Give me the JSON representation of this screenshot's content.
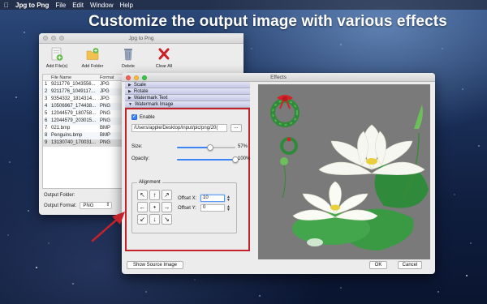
{
  "menubar": {
    "apple_icon": "apple-logo-icon",
    "app_name": "Jpg to Png",
    "items": [
      "File",
      "Edit",
      "Window",
      "Help"
    ]
  },
  "headline": "Customize the output image with various effects",
  "main_window": {
    "title": "Jpg to Png",
    "toolbar": [
      {
        "label": "Add File(s)",
        "icon": "add-file-icon"
      },
      {
        "label": "Add Folder",
        "icon": "add-folder-icon"
      },
      {
        "label": "Delete",
        "icon": "trash-icon"
      },
      {
        "label": "Clear All",
        "icon": "clear-x-icon"
      }
    ],
    "columns": [
      "File Name",
      "Format"
    ],
    "files": [
      {
        "n": "1",
        "name": "9211776_1043556...",
        "fmt": "JPG"
      },
      {
        "n": "2",
        "name": "9211776_1049117...",
        "fmt": "JPG"
      },
      {
        "n": "3",
        "name": "9354332_1814314...",
        "fmt": "JPG"
      },
      {
        "n": "4",
        "name": "10506967_174438...",
        "fmt": "PNG"
      },
      {
        "n": "5",
        "name": "12044579_180758...",
        "fmt": "PNG"
      },
      {
        "n": "6",
        "name": "12044579_203015...",
        "fmt": "PNG"
      },
      {
        "n": "7",
        "name": "021.bmp",
        "fmt": "BMP"
      },
      {
        "n": "8",
        "name": "Penguins.bmp",
        "fmt": "BMP"
      },
      {
        "n": "9",
        "name": "13130740_170031...",
        "fmt": "PNG"
      }
    ],
    "output_folder_label": "Output Folder:",
    "output_format_label": "Output Format:",
    "output_format_value": "PNG"
  },
  "effects": {
    "title": "Effects",
    "sections": [
      "Scale",
      "Rotate",
      "Watermark Text",
      "Watermark Image"
    ],
    "enable_label": "Enable",
    "enable_checked": true,
    "path": "/Users/apple/Desktop/input/pic/png/20(",
    "browse_label": "...",
    "size_label": "Size:",
    "size_value": "57%",
    "size_fraction": 0.57,
    "opacity_label": "Opacity:",
    "opacity_value": "100%",
    "opacity_fraction": 1.0,
    "alignment_label": "Alignment",
    "align_buttons": [
      "↖",
      "↑",
      "↗",
      "←",
      "•",
      "→",
      "↙",
      "↓",
      "↘"
    ],
    "offset_x_label": "Offset X:",
    "offset_x_value": "10",
    "offset_y_label": "Offset Y:",
    "offset_y_value": "0",
    "show_source_label": "Show Source Image",
    "ok_label": "OK",
    "cancel_label": "Cancel"
  },
  "colors": {
    "highlight_border": "#c4222a",
    "accent": "#3b84f6"
  }
}
